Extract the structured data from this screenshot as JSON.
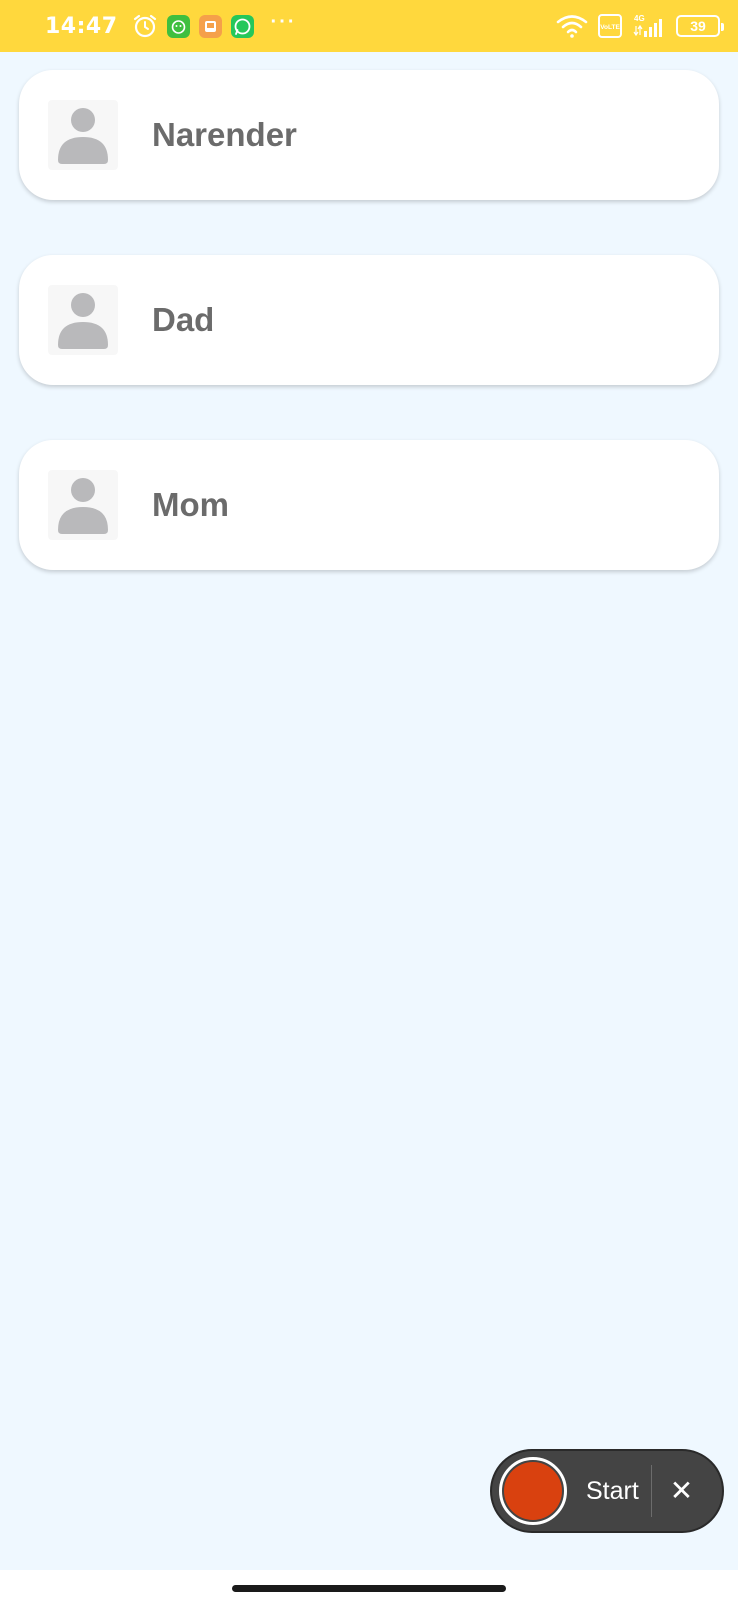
{
  "status_bar": {
    "time": "14:47",
    "battery": "39",
    "network": "4G",
    "volte": "VoLTE",
    "more": "···",
    "background_color": "#ffd83d",
    "icons_left": [
      "alarm-icon",
      "game-app-icon",
      "slides-app-icon",
      "whatsapp-icon"
    ],
    "icons_right": [
      "wifi-icon",
      "volte-icon",
      "signal-icon",
      "battery-icon"
    ]
  },
  "contacts": [
    {
      "name": "Narender",
      "icon": "person-icon"
    },
    {
      "name": "Dad",
      "icon": "person-icon"
    },
    {
      "name": "Mom",
      "icon": "person-icon"
    }
  ],
  "recorder": {
    "label": "Start",
    "close_label": "✕",
    "record_color": "#d9410f"
  },
  "colors": {
    "background": "#eff8ff",
    "card": "#ffffff",
    "name_text": "#6b6b6b"
  }
}
